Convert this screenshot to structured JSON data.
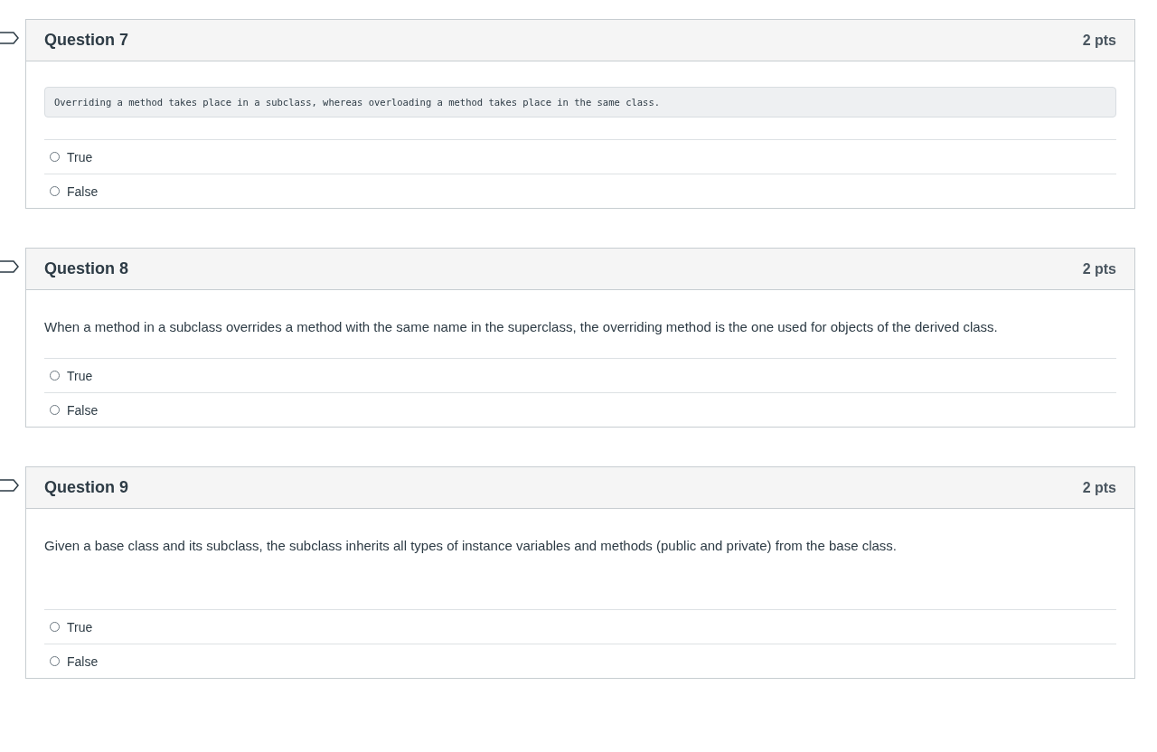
{
  "questions": [
    {
      "title": "Question 7",
      "points": "2 pts",
      "flagged": false,
      "prompt": {
        "kind": "code",
        "text": "Overriding a method takes place in a subclass, whereas overloading a method takes place in the same class."
      },
      "options": [
        {
          "label": "True",
          "selected": false
        },
        {
          "label": "False",
          "selected": false
        }
      ]
    },
    {
      "title": "Question 8",
      "points": "2 pts",
      "flagged": false,
      "prompt": {
        "kind": "text",
        "text": "When a method in a subclass overrides a method with the same name in the superclass, the overriding method is the one used for objects of the derived class."
      },
      "options": [
        {
          "label": "True",
          "selected": false
        },
        {
          "label": "False",
          "selected": false
        }
      ]
    },
    {
      "title": "Question 9",
      "points": "2 pts",
      "flagged": false,
      "prompt": {
        "kind": "text",
        "text": "Given a base class and its subclass, the subclass inherits all types of instance variables and methods (public and private) from the base class."
      },
      "options": [
        {
          "label": "True",
          "selected": false
        },
        {
          "label": "False",
          "selected": false
        }
      ]
    }
  ]
}
